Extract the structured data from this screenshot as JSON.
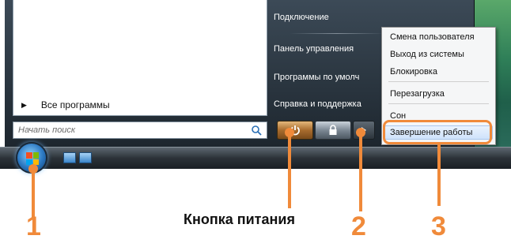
{
  "start_menu": {
    "left_pane": {
      "all_programs_label": "Все программы"
    },
    "search": {
      "placeholder": "Начать поиск"
    },
    "right_pane": {
      "items": [
        "Подключение",
        "Панель управления",
        "Программы по умолч",
        "Справка и поддержка"
      ]
    },
    "power_buttons": {
      "power_icon": "power-icon",
      "lock_icon": "lock-icon",
      "arrow_icon": "arrow-right-icon"
    }
  },
  "context_menu": {
    "items": [
      "Смена пользователя",
      "Выход из системы",
      "Блокировка",
      "Перезагрузка",
      "Сон",
      "Завершение работы"
    ],
    "highlighted_index": 5
  },
  "taskbar": {
    "start_icon": "windows-start-orb",
    "quick_launch": [
      "show-desktop-icon",
      "switch-windows-icon"
    ]
  },
  "annotations": {
    "numbers": [
      "1",
      "2",
      "3"
    ],
    "power_label": "Кнопка питания",
    "accent_color": "#f08a3a"
  }
}
